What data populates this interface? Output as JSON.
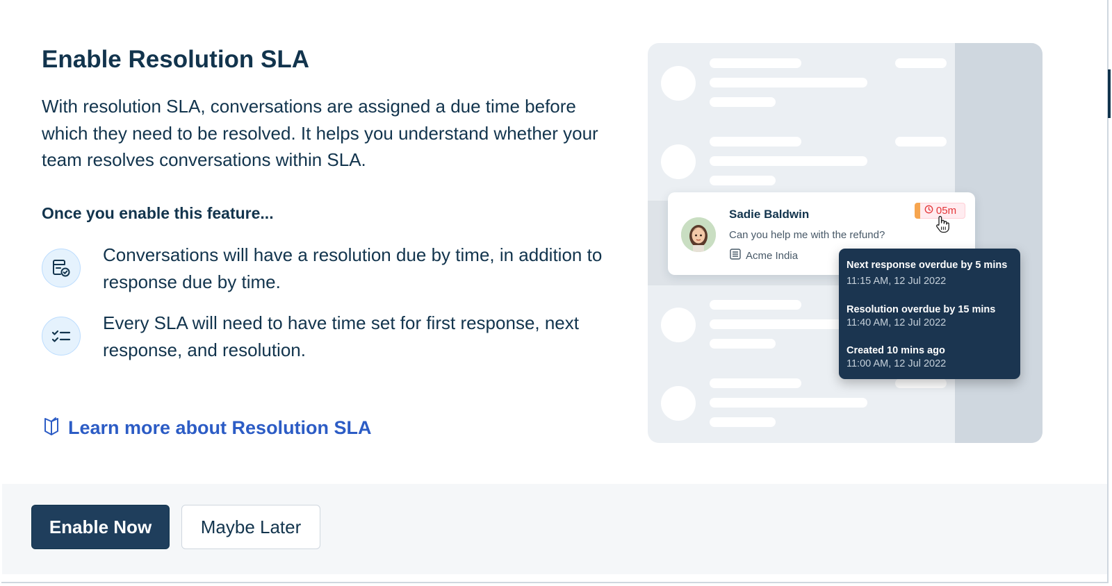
{
  "modal": {
    "title": "Enable Resolution SLA",
    "description": "With resolution SLA, conversations are assigned a due time before which they need to be resolved. It helps you understand whether your team resolves conversations within SLA.",
    "subheading": "Once you enable this feature...",
    "features": [
      {
        "icon": "calendar-check-icon",
        "text": "Conversations will have a resolution due by time, in addition to response due by time."
      },
      {
        "icon": "checklist-icon",
        "text": "Every SLA will need to have time set for first response, next response, and resolution."
      }
    ],
    "learn_more": {
      "icon": "book-open-icon",
      "label": "Learn more about Resolution SLA"
    }
  },
  "illustration": {
    "card": {
      "name": "Sadie Baldwin",
      "message": "Can you help me with the refund?",
      "company": "Acme India",
      "timer": "05m"
    },
    "tooltip": [
      {
        "title": "Next response overdue by 5 mins",
        "time": "11:15 AM, 12 Jul 2022"
      },
      {
        "title": "Resolution overdue by 15 mins",
        "time": "11:40 AM, 12 Jul 2022"
      },
      {
        "title": "Created 10 mins ago",
        "time": "11:00 AM, 12 Jul 2022"
      }
    ]
  },
  "footer": {
    "enable_label": "Enable Now",
    "later_label": "Maybe Later"
  },
  "colors": {
    "primary": "#1f3e5c",
    "link": "#2c5cc5",
    "timer": "#e43538",
    "tooltip_bg": "#1b3550"
  }
}
